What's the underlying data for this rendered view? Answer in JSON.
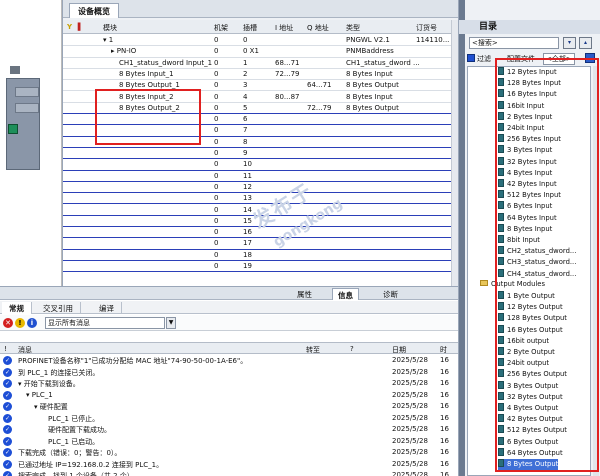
{
  "overview": {
    "tab_title": "设备概览",
    "columns": [
      "模块",
      "机架",
      "插槽",
      "I 地址",
      "Q 地址",
      "类型",
      "订货号"
    ],
    "rows": [
      {
        "module": "▾ 1",
        "rack": "0",
        "slot": "0",
        "i": "",
        "q": "",
        "type": "PNGWL V2.1",
        "order": "114110..."
      },
      {
        "module": "▸ PN-IO",
        "rack": "0",
        "slot": "0 X1",
        "i": "",
        "q": "",
        "type": "PNMBaddress",
        "order": ""
      },
      {
        "module": "CH1_status_dword Input_1",
        "rack": "0",
        "slot": "1",
        "i": "68...71",
        "q": "",
        "type": "CH1_status_dword ...",
        "order": ""
      },
      {
        "module": "8 Bytes Input_1",
        "rack": "0",
        "slot": "2",
        "i": "72...79",
        "q": "",
        "type": "8 Bytes Input",
        "order": ""
      },
      {
        "module": "8 Bytes Output_1",
        "rack": "0",
        "slot": "3",
        "i": "",
        "q": "64...71",
        "type": "8 Bytes Output",
        "order": ""
      },
      {
        "module": "8 Bytes Input_2",
        "rack": "0",
        "slot": "4",
        "i": "80...87",
        "q": "",
        "type": "8 Bytes Input",
        "order": ""
      },
      {
        "module": "8 Bytes Output_2",
        "rack": "0",
        "slot": "5",
        "i": "",
        "q": "72...79",
        "type": "8 Bytes Output",
        "order": ""
      },
      {
        "module": "",
        "rack": "0",
        "slot": "6",
        "i": "",
        "q": "",
        "type": "",
        "order": ""
      },
      {
        "module": "",
        "rack": "0",
        "slot": "7",
        "i": "",
        "q": "",
        "type": "",
        "order": ""
      },
      {
        "module": "",
        "rack": "0",
        "slot": "8",
        "i": "",
        "q": "",
        "type": "",
        "order": ""
      },
      {
        "module": "",
        "rack": "0",
        "slot": "9",
        "i": "",
        "q": "",
        "type": "",
        "order": ""
      },
      {
        "module": "",
        "rack": "0",
        "slot": "10",
        "i": "",
        "q": "",
        "type": "",
        "order": ""
      },
      {
        "module": "",
        "rack": "0",
        "slot": "11",
        "i": "",
        "q": "",
        "type": "",
        "order": ""
      },
      {
        "module": "",
        "rack": "0",
        "slot": "12",
        "i": "",
        "q": "",
        "type": "",
        "order": ""
      },
      {
        "module": "",
        "rack": "0",
        "slot": "13",
        "i": "",
        "q": "",
        "type": "",
        "order": ""
      },
      {
        "module": "",
        "rack": "0",
        "slot": "14",
        "i": "",
        "q": "",
        "type": "",
        "order": ""
      },
      {
        "module": "",
        "rack": "0",
        "slot": "15",
        "i": "",
        "q": "",
        "type": "",
        "order": ""
      },
      {
        "module": "",
        "rack": "0",
        "slot": "16",
        "i": "",
        "q": "",
        "type": "",
        "order": ""
      },
      {
        "module": "",
        "rack": "0",
        "slot": "17",
        "i": "",
        "q": "",
        "type": "",
        "order": ""
      },
      {
        "module": "",
        "rack": "0",
        "slot": "18",
        "i": "",
        "q": "",
        "type": "",
        "order": ""
      },
      {
        "module": "",
        "rack": "0",
        "slot": "19",
        "i": "",
        "q": "",
        "type": "",
        "order": ""
      }
    ]
  },
  "inspector": {
    "tabs": [
      "属性",
      "信息",
      "诊断"
    ],
    "active_tab": "信息",
    "subtabs": [
      "常规",
      "交叉引用",
      "编译"
    ],
    "filter_value": "显示所有消息",
    "columns": [
      "!",
      "消息",
      "转至",
      "?",
      "日期",
      "时"
    ],
    "messages": [
      {
        "text": "PROFINET设备名称\"1\"已成功分配给 MAC 地址\"74-90-50-00-1A-E6\"。",
        "date": "2025/5/28",
        "time": "16"
      },
      {
        "text": "到 PLC_1 的连接已关闭。",
        "date": "2025/5/28",
        "time": "16"
      },
      {
        "text": "▾ 开始下载到设备。",
        "date": "2025/5/28",
        "time": "16"
      },
      {
        "text": "▾ PLC_1",
        "date": "2025/5/28",
        "time": "16"
      },
      {
        "text": "▾ 硬件配置",
        "date": "2025/5/28",
        "time": "16"
      },
      {
        "text": "PLC_1 已停止。",
        "date": "2025/5/28",
        "time": "16"
      },
      {
        "text": "硬件配置下载成功。",
        "date": "2025/5/28",
        "time": "16"
      },
      {
        "text": "PLC_1 已启动。",
        "date": "2025/5/28",
        "time": "16"
      },
      {
        "text": "下载完成（错误：0；警告：0）。",
        "date": "2025/5/28",
        "time": "16"
      },
      {
        "text": "已通过地址 IP=192.168.0.2 连接到 PLC_1。",
        "date": "2025/5/28",
        "time": "16"
      },
      {
        "text": "搜索完成。找到 1 个设备（共 2 个）。",
        "date": "2025/5/28",
        "time": "16"
      }
    ]
  },
  "catalog": {
    "title": "目录",
    "search_placeholder": "<搜索>",
    "filter_label": "过滤",
    "profile_label": "配置文件",
    "profile_value": "<全部>",
    "input_items": [
      "12 Bytes Input",
      "128 Bytes Input",
      "16 Bytes Input",
      "16bit Input",
      "2 Bytes Input",
      "24bit Input",
      "256 Bytes Input",
      "3 Bytes Input",
      "32 Bytes Input",
      "4 Bytes Input",
      "42 Bytes Input",
      "512 Bytes Input",
      "6 Bytes Input",
      "64 Bytes Input",
      "8 Bytes Input",
      "8bit Input",
      "CH2_status_dword...",
      "CH3_status_dword...",
      "CH4_status_dword..."
    ],
    "output_folder": "Output Modules",
    "output_items": [
      "1 Byte Output",
      "12 Bytes Output",
      "128 Bytes Output",
      "16 Bytes Output",
      "16bit output",
      "2 Byte Output",
      "24bit output",
      "256 Bytes Output",
      "3 Bytes Output",
      "32 Bytes Output",
      "4 Bytes Output",
      "42 Bytes Output",
      "512 Bytes Output",
      "6 Bytes Output",
      "64 Bytes Output",
      "8 Bytes Output"
    ],
    "selected_item": "8 Bytes Output"
  },
  "watermark": {
    "line1": "发布于",
    "line2": "gongkong"
  }
}
